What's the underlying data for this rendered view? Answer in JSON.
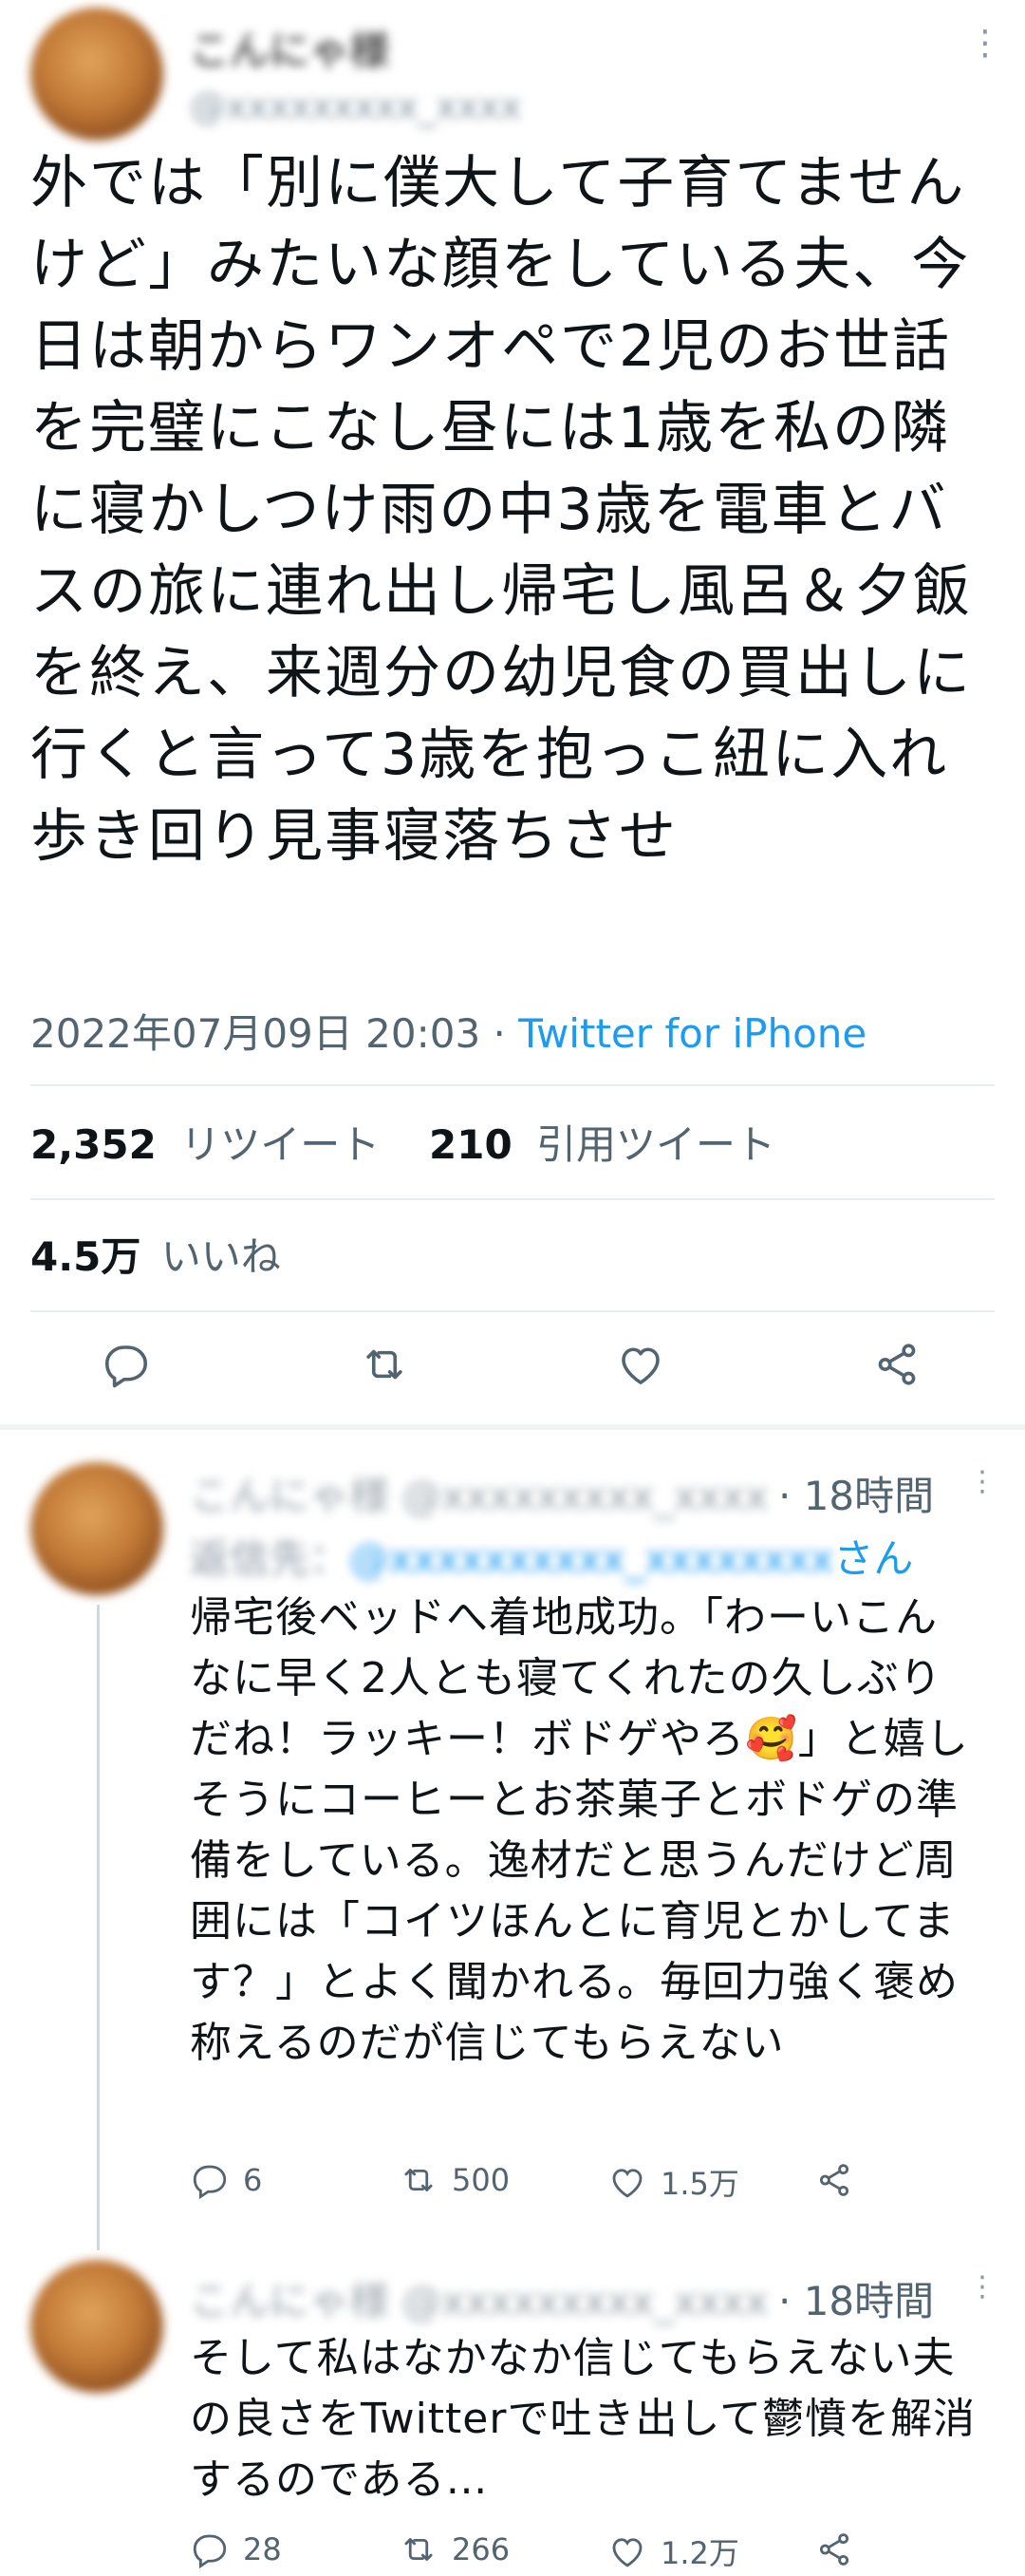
{
  "tweet": {
    "author_name": "こんにゃ様",
    "author_handle": "@xxxxxxxxx_xxxx",
    "text": "外では「別に僕大して子育てませんけど」みたいな顔をしている夫、今日は朝からワンオペで2児のお世話を完璧にこなし昼には1歳を私の隣に寝かしつけ雨の中3歳を電車とバスの旅に連れ出し帰宅し風呂＆夕飯を終え、来週分の幼児食の買出しに行くと言って3歳を抱っこ紐に入れ歩き回り見事寝落ちさせ",
    "timestamp": "2022年07月09日 20:03",
    "separator": "·",
    "client": "Twitter for iPhone",
    "retweets_count": "2,352",
    "retweets_label": "リツイート",
    "quotes_count": "210",
    "quotes_label": "引用ツイート",
    "likes_count": "4.5万",
    "likes_label": "いいね",
    "more_icon": "⋮"
  },
  "replies": [
    {
      "author": "こんにゃ様 @xxxxxxxxx_xxxx",
      "time": "· 18時間",
      "reply_to_prefix": "返信先：",
      "reply_to_handle": "@xxxxxxxxxx_xxxxxxxx",
      "reply_to_suffix": "さん",
      "text": "帰宅後ベッドへ着地成功。「わーいこんなに早く2人とも寝てくれたの久しぶりだね！ラッキー！ボドゲやろ🥰」と嬉しそうにコーヒーとお茶菓子とボドゲの準備をしている。逸材だと思うんだけど周囲には「コイツほんとに育児とかしてます？」とよく聞かれる。毎回力強く褒め称えるのだが信じてもらえない",
      "reply_count": "6",
      "retweet_count": "500",
      "like_count": "1.5万"
    },
    {
      "author": "こんにゃ様 @xxxxxxxxx_xxxx",
      "time": "· 18時間",
      "text": "そして私はなかなか信じてもらえない夫の良さをTwitterで吐き出して鬱憤を解消するのである…",
      "reply_count": "28",
      "retweet_count": "266",
      "like_count": "1.2万"
    }
  ],
  "colors": {
    "link": "#1d9bf0",
    "muted": "#536471",
    "divider": "#e6ecf0"
  }
}
